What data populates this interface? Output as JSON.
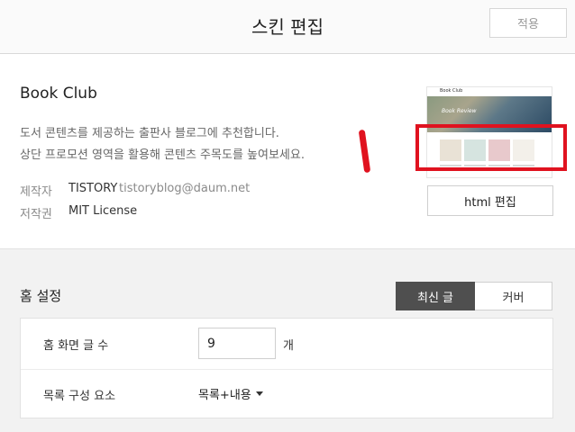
{
  "header": {
    "title": "스킨 편집",
    "apply_label": "적용"
  },
  "skin": {
    "name": "Book Club",
    "description_line1": "도서 콘텐츠를 제공하는 출판사 블로그에 추천합니다.",
    "description_line2": "상단 프로모션 영역을 활용해 콘텐츠 주목도를 높여보세요.",
    "author_label": "제작자",
    "author_name": "TISTORY",
    "author_email": "tistoryblog@daum.net",
    "license_label": "저작권",
    "license_value": "MIT License",
    "thumbnail": {
      "brand": "Book Club",
      "hero_text": "Book Review"
    },
    "html_edit_label": "html 편집"
  },
  "home_settings": {
    "title": "홈 설정",
    "toggle": {
      "latest_label": "최신 글",
      "cover_label": "커버",
      "selected": "최신 글"
    },
    "post_count_label": "홈 화면 글 수",
    "post_count_value": "9",
    "post_count_unit": "개",
    "list_composition_label": "목록 구성 요소",
    "list_composition_value": "목록+내용"
  },
  "colors": {
    "highlight": "#e0121f",
    "toggle_active": "#4f4f4f"
  }
}
